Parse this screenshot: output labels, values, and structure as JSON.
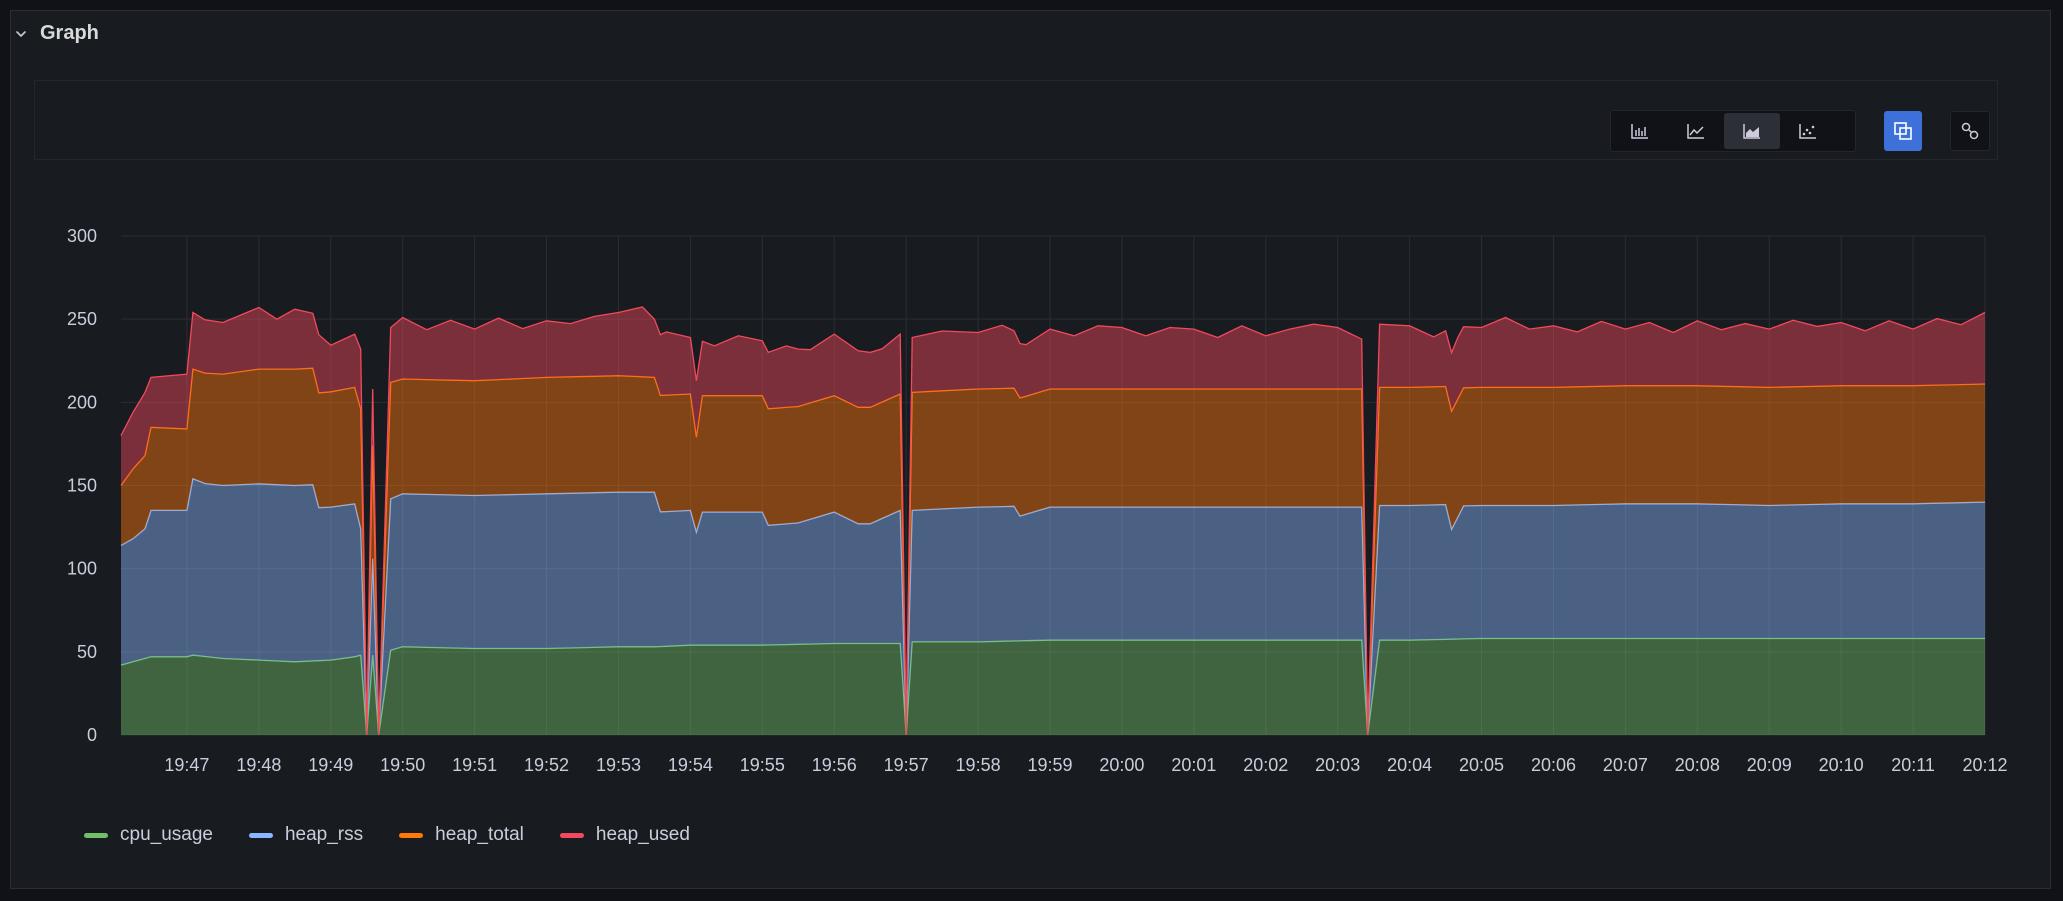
{
  "panel": {
    "title": "Graph",
    "toolbar": {
      "chart_types": [
        {
          "name": "bar-chart",
          "active": false
        },
        {
          "name": "line-chart",
          "active": false
        },
        {
          "name": "area-chart",
          "active": true
        },
        {
          "name": "scatter-chart",
          "active": false
        }
      ],
      "stack_toggle": {
        "active": true
      },
      "link_toggle": {
        "active": false
      }
    }
  },
  "colors": {
    "cpu_usage": "#73bf69",
    "heap_rss": "#8ab8ff",
    "heap_total": "#ff780a",
    "heap_used": "#f2495c",
    "accent": "#3d71d9"
  },
  "chart_data": {
    "type": "area",
    "stacked": true,
    "ylim": [
      0,
      300
    ],
    "yticks": [
      "0",
      "50",
      "100",
      "150",
      "200",
      "250",
      "300"
    ],
    "xtick_labels": [
      "19:47",
      "19:48",
      "19:49",
      "19:50",
      "19:51",
      "19:52",
      "19:53",
      "19:54",
      "19:55",
      "19:56",
      "19:57",
      "19:58",
      "19:59",
      "20:00",
      "20:01",
      "20:02",
      "20:03",
      "20:04",
      "20:05",
      "20:06",
      "20:07",
      "20:08",
      "20:09",
      "20:10",
      "20:11",
      "20:12"
    ],
    "x_start": "19:46:05",
    "x_end": "20:12:00",
    "grid": true,
    "legend": "bottom-left",
    "series": [
      {
        "name": "cpu_usage",
        "points": [
          [
            "19:46:05",
            42
          ],
          [
            "19:46:15",
            44
          ],
          [
            "19:46:30",
            47
          ],
          [
            "19:47:00",
            47
          ],
          [
            "19:47:05",
            48
          ],
          [
            "19:47:30",
            46
          ],
          [
            "19:48:00",
            45
          ],
          [
            "19:48:30",
            44
          ],
          [
            "19:49:00",
            45
          ],
          [
            "19:49:20",
            47
          ],
          [
            "19:49:25",
            48
          ],
          [
            "19:49:30",
            0
          ],
          [
            "19:49:35",
            48
          ],
          [
            "19:49:40",
            0
          ],
          [
            "19:49:50",
            51
          ],
          [
            "19:50:00",
            53
          ],
          [
            "19:51:00",
            52
          ],
          [
            "19:52:00",
            52
          ],
          [
            "19:53:00",
            53
          ],
          [
            "19:53:30",
            53
          ],
          [
            "19:54:00",
            54
          ],
          [
            "19:55:00",
            54
          ],
          [
            "19:56:00",
            55
          ],
          [
            "19:56:55",
            55
          ],
          [
            "19:57:00",
            0
          ],
          [
            "19:57:05",
            56
          ],
          [
            "19:58:00",
            56
          ],
          [
            "19:59:00",
            57
          ],
          [
            "20:00:00",
            57
          ],
          [
            "20:01:00",
            57
          ],
          [
            "20:02:00",
            57
          ],
          [
            "20:03:00",
            57
          ],
          [
            "20:03:20",
            57
          ],
          [
            "20:03:25",
            0
          ],
          [
            "20:03:35",
            57
          ],
          [
            "20:04:00",
            57
          ],
          [
            "20:05:00",
            58
          ],
          [
            "20:06:00",
            58
          ],
          [
            "20:07:00",
            58
          ],
          [
            "20:08:00",
            58
          ],
          [
            "20:09:00",
            58
          ],
          [
            "20:10:00",
            58
          ],
          [
            "20:11:00",
            58
          ],
          [
            "20:12:00",
            58
          ]
        ]
      },
      {
        "name": "heap_rss",
        "points": [
          [
            "19:46:05",
            72
          ],
          [
            "19:46:15",
            74
          ],
          [
            "19:46:25",
            78
          ],
          [
            "19:46:30",
            88
          ],
          [
            "19:47:00",
            88
          ],
          [
            "19:47:05",
            106
          ],
          [
            "19:47:15",
            104
          ],
          [
            "19:47:30",
            104
          ],
          [
            "19:48:00",
            106
          ],
          [
            "19:48:30",
            106
          ],
          [
            "19:48:45",
            106
          ],
          [
            "19:48:50",
            92
          ],
          [
            "19:49:20",
            92
          ],
          [
            "19:49:25",
            76
          ],
          [
            "19:49:30",
            0
          ],
          [
            "19:49:35",
            58
          ],
          [
            "19:49:40",
            0
          ],
          [
            "19:49:50",
            91
          ],
          [
            "19:50:00",
            92
          ],
          [
            "19:51:00",
            92
          ],
          [
            "19:52:00",
            93
          ],
          [
            "19:53:00",
            93
          ],
          [
            "19:53:30",
            93
          ],
          [
            "19:53:35",
            81
          ],
          [
            "19:54:00",
            81
          ],
          [
            "19:54:05",
            68
          ],
          [
            "19:54:10",
            80
          ],
          [
            "19:55:00",
            80
          ],
          [
            "19:55:05",
            72
          ],
          [
            "19:55:30",
            73
          ],
          [
            "19:56:00",
            79
          ],
          [
            "19:56:20",
            72
          ],
          [
            "19:56:30",
            72
          ],
          [
            "19:56:55",
            80
          ],
          [
            "19:57:00",
            0
          ],
          [
            "19:57:05",
            79
          ],
          [
            "19:58:00",
            81
          ],
          [
            "19:58:30",
            81
          ],
          [
            "19:58:35",
            75
          ],
          [
            "19:59:00",
            80
          ],
          [
            "20:00:00",
            80
          ],
          [
            "20:01:00",
            80
          ],
          [
            "20:02:00",
            80
          ],
          [
            "20:03:00",
            80
          ],
          [
            "20:03:20",
            80
          ],
          [
            "20:03:25",
            0
          ],
          [
            "20:03:35",
            81
          ],
          [
            "20:04:00",
            81
          ],
          [
            "20:04:30",
            81
          ],
          [
            "20:04:35",
            66
          ],
          [
            "20:04:45",
            80
          ],
          [
            "20:05:00",
            80
          ],
          [
            "20:06:00",
            80
          ],
          [
            "20:07:00",
            81
          ],
          [
            "20:08:00",
            81
          ],
          [
            "20:09:00",
            80
          ],
          [
            "20:10:00",
            81
          ],
          [
            "20:11:00",
            81
          ],
          [
            "20:12:00",
            82
          ]
        ]
      },
      {
        "name": "heap_total",
        "points": [
          [
            "19:46:05",
            36
          ],
          [
            "19:46:15",
            42
          ],
          [
            "19:46:25",
            44
          ],
          [
            "19:46:30",
            50
          ],
          [
            "19:47:00",
            49
          ],
          [
            "19:47:05",
            66
          ],
          [
            "19:47:30",
            67
          ],
          [
            "19:48:00",
            69
          ],
          [
            "19:48:30",
            70
          ],
          [
            "19:48:45",
            70
          ],
          [
            "19:48:50",
            69
          ],
          [
            "19:49:20",
            70
          ],
          [
            "19:49:25",
            72
          ],
          [
            "19:49:30",
            0
          ],
          [
            "19:49:35",
            68
          ],
          [
            "19:49:40",
            0
          ],
          [
            "19:49:50",
            70
          ],
          [
            "19:50:00",
            69
          ],
          [
            "19:51:00",
            69
          ],
          [
            "19:52:00",
            70
          ],
          [
            "19:53:00",
            70
          ],
          [
            "19:53:30",
            69
          ],
          [
            "19:53:35",
            70
          ],
          [
            "19:54:00",
            70
          ],
          [
            "19:54:05",
            57
          ],
          [
            "19:54:10",
            70
          ],
          [
            "19:55:00",
            70
          ],
          [
            "19:55:05",
            70
          ],
          [
            "19:56:00",
            70
          ],
          [
            "19:56:30",
            70
          ],
          [
            "19:56:55",
            70
          ],
          [
            "19:57:00",
            0
          ],
          [
            "19:57:05",
            71
          ],
          [
            "19:58:00",
            71
          ],
          [
            "19:58:30",
            71
          ],
          [
            "19:58:35",
            71
          ],
          [
            "19:59:00",
            71
          ],
          [
            "20:00:00",
            71
          ],
          [
            "20:01:00",
            71
          ],
          [
            "20:02:00",
            71
          ],
          [
            "20:03:00",
            71
          ],
          [
            "20:03:20",
            71
          ],
          [
            "20:03:25",
            0
          ],
          [
            "20:03:35",
            71
          ],
          [
            "20:04:00",
            71
          ],
          [
            "20:04:30",
            71
          ],
          [
            "20:04:35",
            71
          ],
          [
            "20:04:45",
            71
          ],
          [
            "20:05:00",
            71
          ],
          [
            "20:06:00",
            71
          ],
          [
            "20:07:00",
            71
          ],
          [
            "20:08:00",
            71
          ],
          [
            "20:09:00",
            71
          ],
          [
            "20:10:00",
            71
          ],
          [
            "20:11:00",
            71
          ],
          [
            "20:12:00",
            71
          ]
        ]
      },
      {
        "name": "heap_used",
        "points": [
          [
            "19:46:05",
            30
          ],
          [
            "19:46:15",
            34
          ],
          [
            "19:46:25",
            38
          ],
          [
            "19:46:30",
            30
          ],
          [
            "19:47:00",
            33
          ],
          [
            "19:47:05",
            34
          ],
          [
            "19:47:15",
            32
          ],
          [
            "19:47:30",
            31
          ],
          [
            "19:48:00",
            37
          ],
          [
            "19:48:15",
            30
          ],
          [
            "19:48:30",
            36
          ],
          [
            "19:48:45",
            33
          ],
          [
            "19:48:50",
            35
          ],
          [
            "19:49:00",
            28
          ],
          [
            "19:49:20",
            32
          ],
          [
            "19:49:25",
            36
          ],
          [
            "19:49:30",
            0
          ],
          [
            "19:49:35",
            34
          ],
          [
            "19:49:40",
            0
          ],
          [
            "19:49:50",
            33
          ],
          [
            "19:50:00",
            37
          ],
          [
            "19:50:20",
            30
          ],
          [
            "19:50:40",
            36
          ],
          [
            "19:51:00",
            31
          ],
          [
            "19:51:20",
            37
          ],
          [
            "19:51:40",
            30
          ],
          [
            "19:52:00",
            34
          ],
          [
            "19:52:20",
            32
          ],
          [
            "19:52:40",
            36
          ],
          [
            "19:53:00",
            38
          ],
          [
            "19:53:20",
            42
          ],
          [
            "19:53:30",
            35
          ],
          [
            "19:53:40",
            38
          ],
          [
            "19:54:00",
            34
          ],
          [
            "19:54:05",
            34
          ],
          [
            "19:54:20",
            30
          ],
          [
            "19:54:40",
            36
          ],
          [
            "19:55:00",
            33
          ],
          [
            "19:55:20",
            37
          ],
          [
            "19:55:40",
            32
          ],
          [
            "19:56:00",
            37
          ],
          [
            "19:56:20",
            34
          ],
          [
            "19:56:40",
            32
          ],
          [
            "19:56:55",
            36
          ],
          [
            "19:57:00",
            0
          ],
          [
            "19:57:05",
            33
          ],
          [
            "19:57:30",
            36
          ],
          [
            "19:58:00",
            34
          ],
          [
            "19:58:20",
            38
          ],
          [
            "19:58:40",
            31
          ],
          [
            "19:59:00",
            36
          ],
          [
            "19:59:20",
            32
          ],
          [
            "19:59:40",
            38
          ],
          [
            "20:00:00",
            37
          ],
          [
            "20:00:20",
            32
          ],
          [
            "20:00:40",
            37
          ],
          [
            "20:01:00",
            36
          ],
          [
            "20:01:20",
            31
          ],
          [
            "20:01:40",
            38
          ],
          [
            "20:02:00",
            32
          ],
          [
            "20:02:20",
            36
          ],
          [
            "20:02:40",
            39
          ],
          [
            "20:03:00",
            37
          ],
          [
            "20:03:20",
            30
          ],
          [
            "20:03:25",
            0
          ],
          [
            "20:03:35",
            38
          ],
          [
            "20:04:00",
            37
          ],
          [
            "20:04:20",
            30
          ],
          [
            "20:04:40",
            37
          ],
          [
            "20:05:00",
            36
          ],
          [
            "20:05:20",
            42
          ],
          [
            "20:05:40",
            35
          ],
          [
            "20:06:00",
            37
          ],
          [
            "20:06:20",
            33
          ],
          [
            "20:06:40",
            39
          ],
          [
            "20:07:00",
            34
          ],
          [
            "20:07:20",
            38
          ],
          [
            "20:07:40",
            32
          ],
          [
            "20:08:00",
            39
          ],
          [
            "20:08:20",
            34
          ],
          [
            "20:08:40",
            38
          ],
          [
            "20:09:00",
            35
          ],
          [
            "20:09:20",
            40
          ],
          [
            "20:09:40",
            36
          ],
          [
            "20:10:00",
            38
          ],
          [
            "20:10:20",
            33
          ],
          [
            "20:10:40",
            39
          ],
          [
            "20:11:00",
            34
          ],
          [
            "20:11:20",
            40
          ],
          [
            "20:11:40",
            36
          ],
          [
            "20:12:00",
            43
          ]
        ]
      }
    ]
  },
  "legend_items": [
    {
      "label": "cpu_usage",
      "color": "#73bf69"
    },
    {
      "label": "heap_rss",
      "color": "#8ab8ff"
    },
    {
      "label": "heap_total",
      "color": "#ff780a"
    },
    {
      "label": "heap_used",
      "color": "#f2495c"
    }
  ]
}
